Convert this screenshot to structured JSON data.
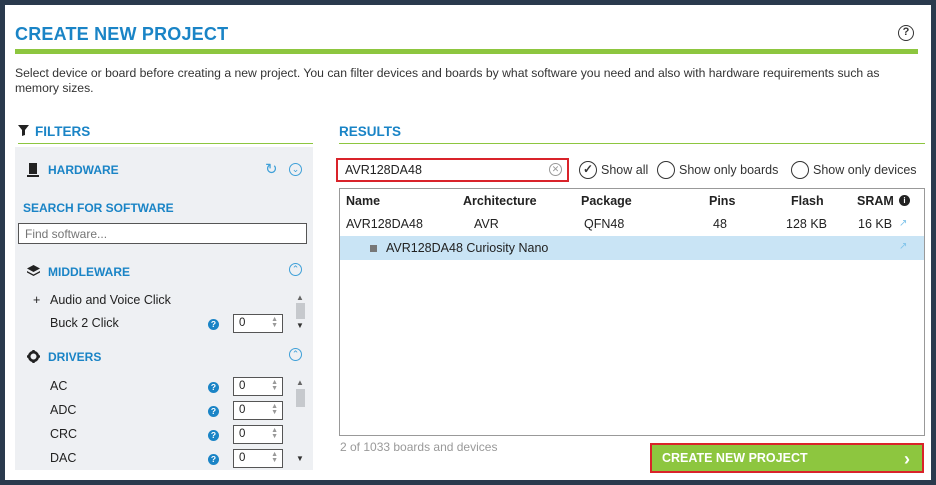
{
  "header": {
    "title": "CREATE NEW PROJECT",
    "help": "?",
    "description": "Select device or board before creating a new project. You can filter devices and boards by what software you need and also with hardware requirements such as memory sizes."
  },
  "filters": {
    "heading": "FILTERS",
    "hardware": "HARDWARE",
    "search_label": "SEARCH FOR SOFTWARE",
    "search_placeholder": "Find software...",
    "middleware": {
      "heading": "MIDDLEWARE",
      "items": [
        {
          "label": "Audio and Voice Click",
          "prefix": "+"
        },
        {
          "label": "Buck 2 Click",
          "value": "0"
        }
      ]
    },
    "drivers": {
      "heading": "DRIVERS",
      "items": [
        {
          "label": "AC",
          "value": "0"
        },
        {
          "label": "ADC",
          "value": "0"
        },
        {
          "label": "CRC",
          "value": "0"
        },
        {
          "label": "DAC",
          "value": "0"
        }
      ]
    }
  },
  "results": {
    "heading": "RESULTS",
    "search_value": "AVR128DA48",
    "options": [
      "Show all",
      "Show only boards",
      "Show only devices"
    ],
    "selected_option": "Show all",
    "columns": [
      "Name",
      "Architecture",
      "Package",
      "Pins",
      "Flash",
      "SRAM"
    ],
    "rows": [
      {
        "name": "AVR128DA48",
        "architecture": "AVR",
        "package": "QFN48",
        "pins": "48",
        "flash": "128 KB",
        "sram": "16 KB"
      }
    ],
    "board_row": "AVR128DA48 Curiosity Nano",
    "count_text": "2 of 1033 boards and devices"
  },
  "footer": {
    "create_label": "CREATE NEW PROJECT",
    "create_chevron": "›"
  },
  "colors": {
    "accent": "#1a84c6",
    "green": "#8dc63f",
    "highlight": "#d9232a",
    "selected_row": "#c9e4f5"
  }
}
